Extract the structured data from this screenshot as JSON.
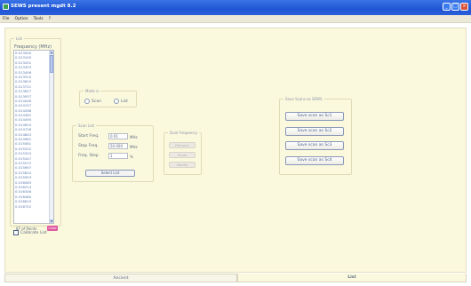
{
  "window": {
    "title": "SEWS present mgdt 8.2"
  },
  "menu": {
    "items": [
      "File",
      "Option",
      "Tools",
      "?"
    ]
  },
  "list_group": {
    "legend": "List",
    "header": "Frequency (MHz)",
    "items": [
      "0.013000",
      "0.013100",
      "0.013201",
      "0.013303",
      "0.013406",
      "0.013510",
      "0.013615",
      "0.013721",
      "0.013827",
      "0.013937",
      "0.014046",
      "0.014157",
      "0.014268",
      "0.014381",
      "0.014495",
      "0.014610",
      "0.014726",
      "0.014843",
      "0.014961",
      "0.015081",
      "0.015202",
      "0.015324",
      "0.015447",
      "0.015572",
      "0.015697",
      "0.015824",
      "0.015953",
      "0.016083",
      "0.016214",
      "0.016346",
      "0.016480",
      "0.016615",
      "0.016752"
    ],
    "points_label": "87 of Points",
    "clear_label": "Clear"
  },
  "checkbox": {
    "label": "Calibrate List"
  },
  "mode": {
    "legend": "Mode is",
    "options": [
      "Scan",
      "List"
    ]
  },
  "scan_list": {
    "legend": "Scan List",
    "start_label": "Start Freq.",
    "start_value": "0.01",
    "stop_label": "Stop Freq.",
    "stop_value": "50.000",
    "step_label": "Freq. Step",
    "step_value": "1",
    "unit_mhz": "MHz",
    "unit_pct": "%",
    "select_label": "Select List"
  },
  "dual_freq": {
    "legend": "Dual Frequency",
    "buttons": [
      "Remove",
      "Scale",
      "Modify"
    ]
  },
  "save_scan": {
    "legend": "Save Scans as SEWS",
    "buttons": [
      "Save scan as Sc1",
      "Save scan as Sc2",
      "Save scan as Sc3",
      "Save scan as Sc4"
    ]
  },
  "tabs": {
    "items": [
      "Ancient",
      "List"
    ],
    "active_index": 1
  },
  "colors": {
    "titlebar": "#2a5fd8",
    "client_bg": "#fbf9dd",
    "clear_btn": "#e05aa0"
  }
}
